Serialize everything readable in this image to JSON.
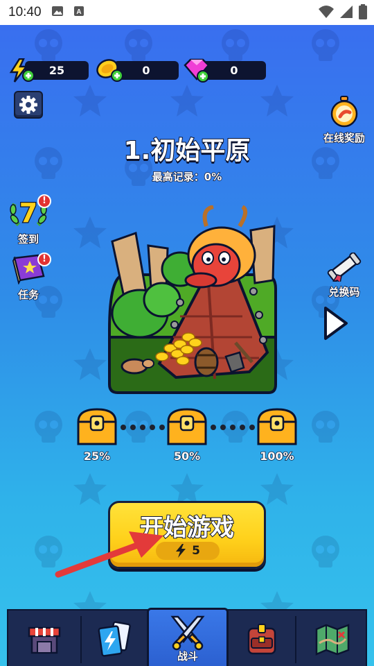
{
  "status_bar": {
    "time": "10:40"
  },
  "resources": {
    "energy": {
      "value": "25",
      "icon": "lightning-plus-icon"
    },
    "coins": {
      "value": "0",
      "icon": "gold-coin-plus-icon"
    },
    "gems": {
      "value": "0",
      "icon": "pink-gem-plus-icon"
    }
  },
  "level": {
    "title": "1.初始平原",
    "best_record": "最高记录：0%"
  },
  "left_buttons": {
    "checkin": {
      "label": "签到",
      "badge": "!",
      "day": "7"
    },
    "tasks": {
      "label": "任务",
      "badge": "!"
    }
  },
  "right_buttons": {
    "online_reward": {
      "label": "在线奖励"
    },
    "redeem_code": {
      "label": "兑换码"
    }
  },
  "progress": {
    "milestones": [
      "25%",
      "50%",
      "100%"
    ],
    "current": 0
  },
  "start_button": {
    "label": "开始游戏",
    "cost": "5"
  },
  "tabs": [
    {
      "name": "shop",
      "label": ""
    },
    {
      "name": "cards",
      "label": ""
    },
    {
      "name": "battle",
      "label": "战斗",
      "active": true
    },
    {
      "name": "backpack",
      "label": ""
    },
    {
      "name": "map",
      "label": ""
    }
  ],
  "colors": {
    "bg_top": "#3a6cf0",
    "bg_bottom": "#36c2ec",
    "button_yellow": "#ffd21c",
    "tabbar": "#1c2a52",
    "badge_red": "#e23232"
  }
}
